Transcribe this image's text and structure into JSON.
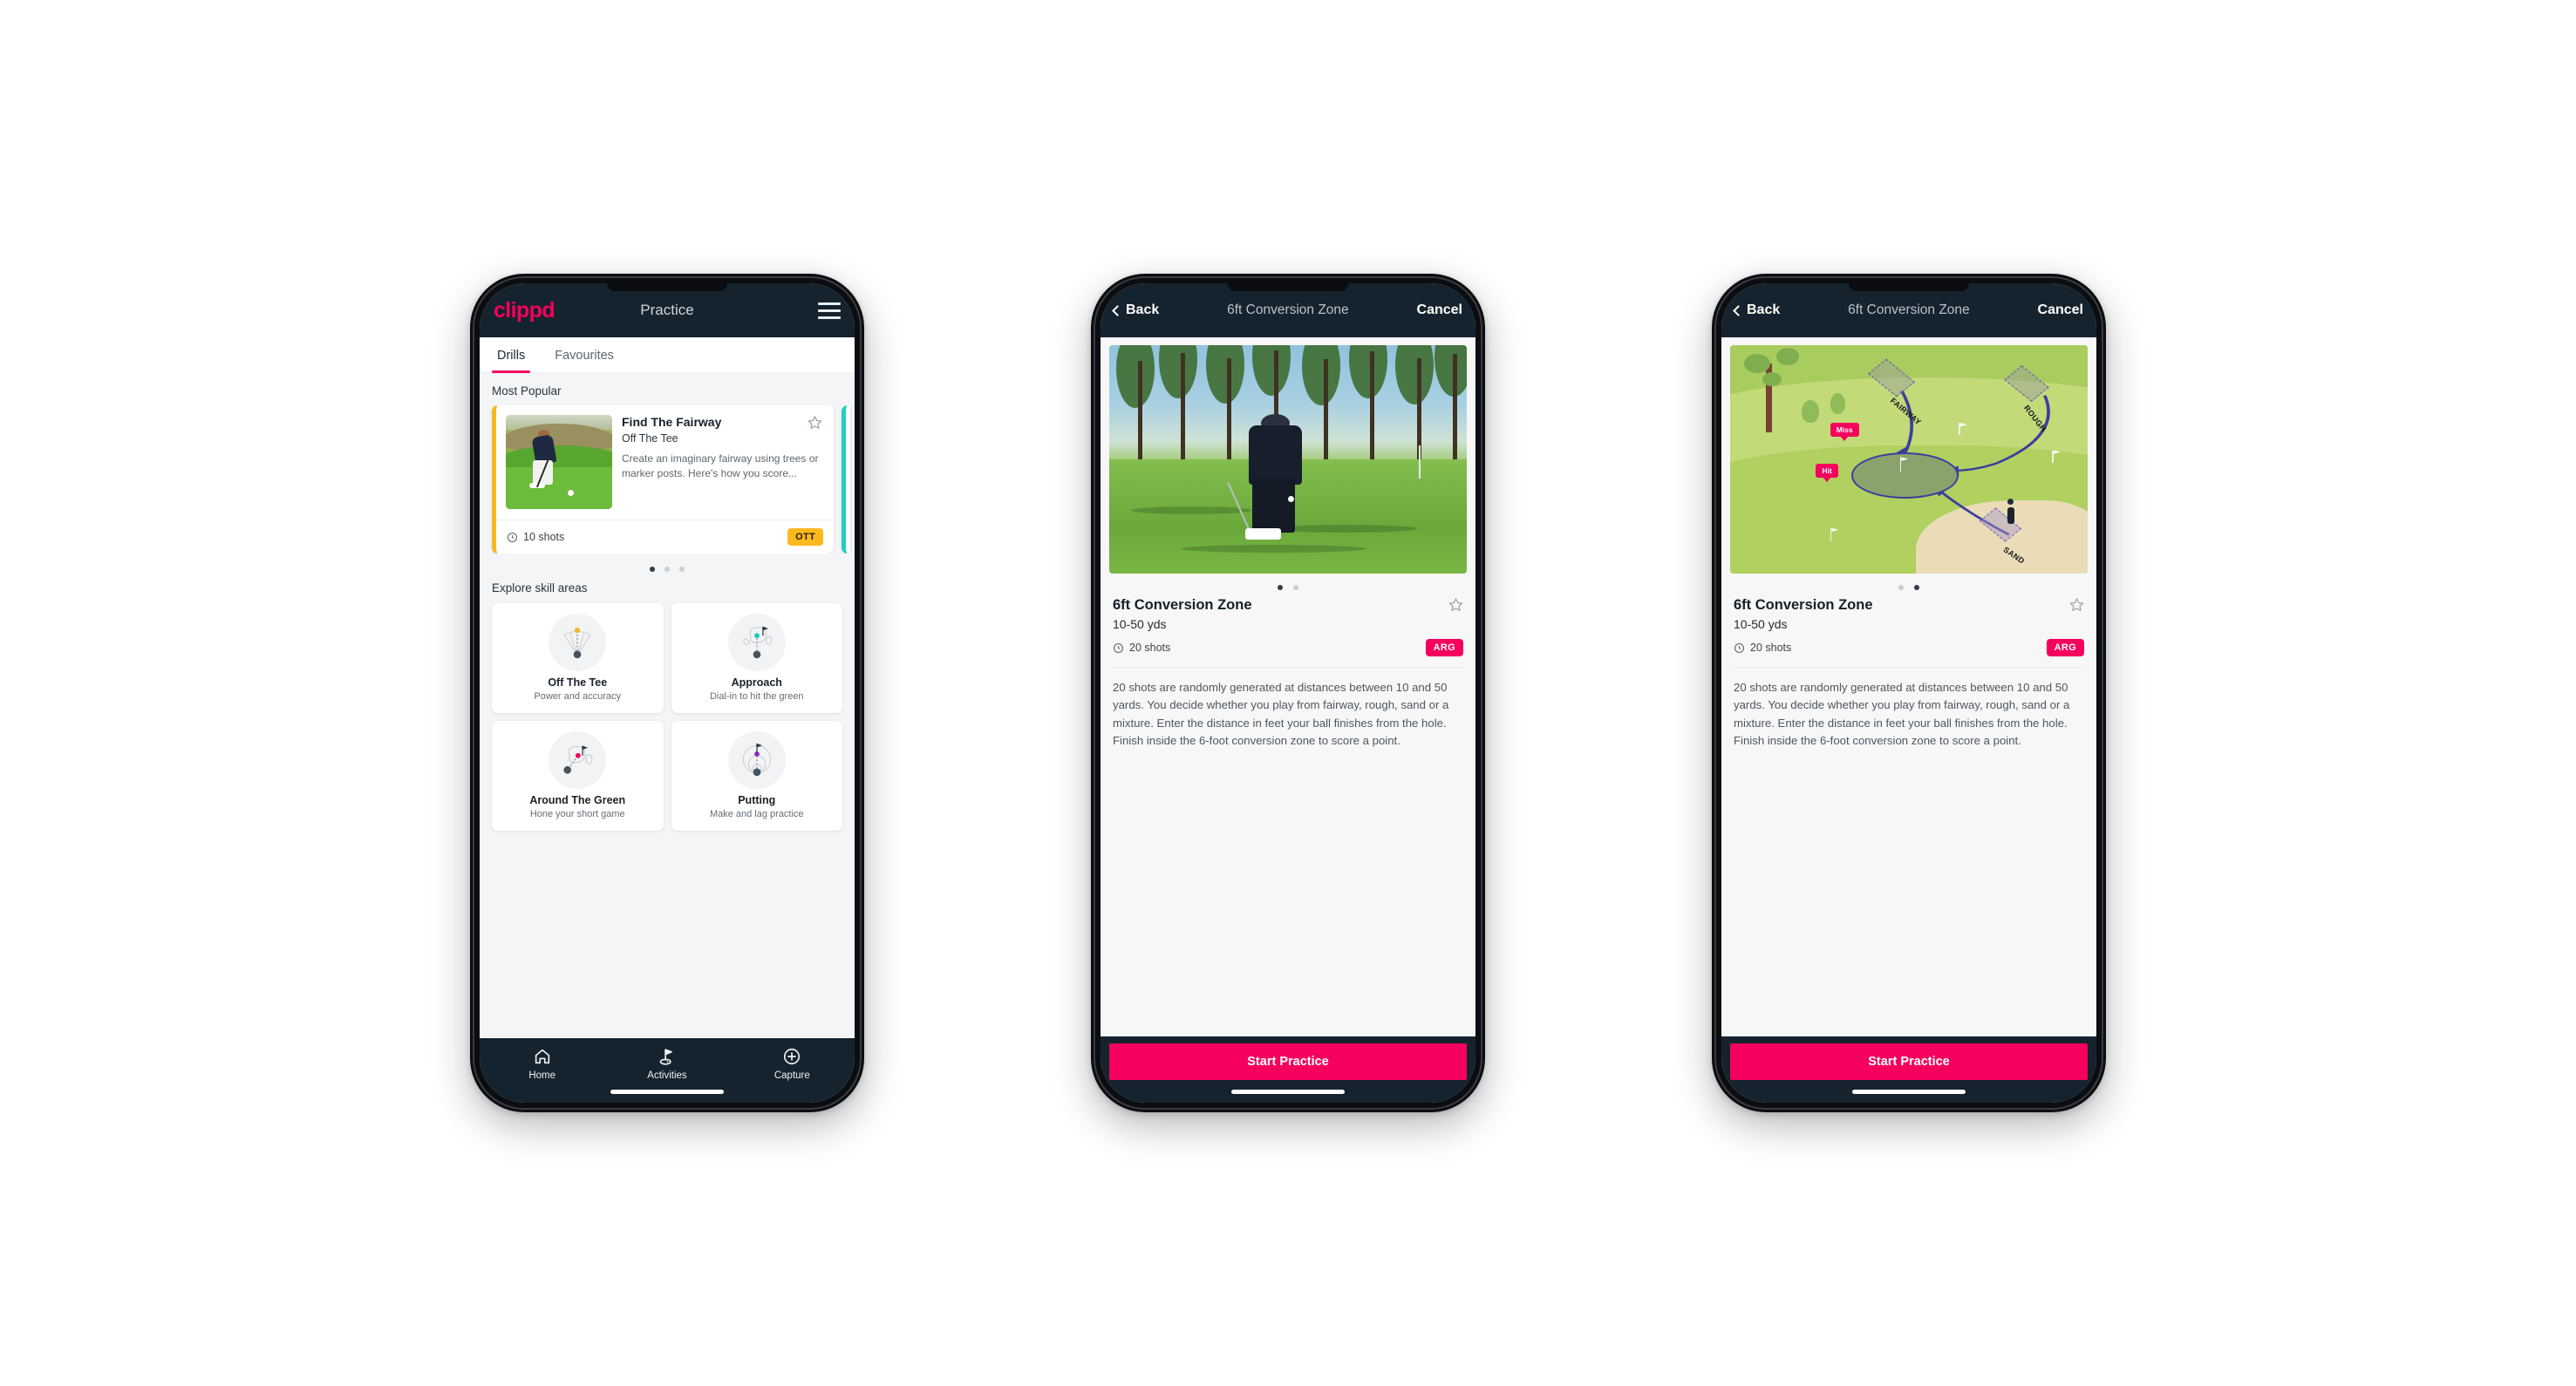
{
  "app": {
    "logo": "clippd",
    "accent_pink": "#f5005e",
    "header_navy": "#15232e",
    "badge_yellow": "#fcb91e",
    "accent_teal": "#21cfc0"
  },
  "phone1": {
    "appbar": {
      "title": "Practice",
      "menu_icon": "hamburger-icon"
    },
    "tabs": [
      {
        "label": "Drills",
        "active": true
      },
      {
        "label": "Favourites",
        "active": false
      }
    ],
    "most_popular": {
      "section_label": "Most Popular",
      "card": {
        "title": "Find The Fairway",
        "subtitle": "Off The Tee",
        "description": "Create an imaginary fairway using trees or marker posts. Here's how you score...",
        "shots": "10 shots",
        "badge": "OTT",
        "badge_color": "#fcb91e",
        "accent_color": "#f5b723",
        "favourite_icon": "star-outline-icon",
        "shots_icon": "clock-icon"
      },
      "dots": {
        "count": 3,
        "active_index": 0
      }
    },
    "skills": {
      "section_label": "Explore skill areas",
      "items": [
        {
          "name": "Off The Tee",
          "desc": "Power and accuracy",
          "icon": "tee-fan-icon",
          "dot_color": "#f5b723"
        },
        {
          "name": "Approach",
          "desc": "Dial-in to hit the green",
          "icon": "approach-green-icon",
          "dot_color": "#1fc9b6"
        },
        {
          "name": "Around The Green",
          "desc": "Hone your short game",
          "icon": "chip-green-icon",
          "dot_color": "#f5005e"
        },
        {
          "name": "Putting",
          "desc": "Make and lag practice",
          "icon": "putting-rings-icon",
          "dot_color": "#a12ad0"
        }
      ]
    },
    "bottomnav": [
      {
        "label": "Home",
        "icon": "home-icon",
        "active": false
      },
      {
        "label": "Activities",
        "icon": "golf-flag-icon",
        "active": true
      },
      {
        "label": "Capture",
        "icon": "plus-circle-icon",
        "active": false
      }
    ]
  },
  "phone2": {
    "appbar": {
      "back": "Back",
      "title": "6ft Conversion Zone",
      "cancel": "Cancel",
      "back_icon": "chevron-left-icon"
    },
    "hero": {
      "type": "photo",
      "alt": "golfer-chipping-photo"
    },
    "dots": {
      "count": 2,
      "active_index": 0
    },
    "detail": {
      "title": "6ft Conversion Zone",
      "subtitle": "10-50 yds",
      "shots": "20 shots",
      "badge": "ARG",
      "badge_color": "#f5005e",
      "favourite_icon": "star-outline-icon",
      "shots_icon": "clock-icon",
      "description": "20 shots are randomly generated at distances between 10 and 50 yards. You decide whether you play from fairway, rough, sand or a mixture. Enter the distance in feet your ball finishes from the hole. Finish inside the 6-foot conversion zone to score a point."
    },
    "cta": "Start Practice"
  },
  "phone3": {
    "appbar": {
      "back": "Back",
      "title": "6ft Conversion Zone",
      "cancel": "Cancel",
      "back_icon": "chevron-left-icon"
    },
    "hero": {
      "type": "illustration",
      "alt": "golf-course-diagram",
      "zone_labels": [
        "FAIRWAY",
        "ROUGH",
        "SAND"
      ],
      "result_tags": [
        "Miss",
        "Hit"
      ]
    },
    "dots": {
      "count": 2,
      "active_index": 1
    },
    "detail": {
      "title": "6ft Conversion Zone",
      "subtitle": "10-50 yds",
      "shots": "20 shots",
      "badge": "ARG",
      "badge_color": "#f5005e",
      "favourite_icon": "star-outline-icon",
      "shots_icon": "clock-icon",
      "description": "20 shots are randomly generated at distances between 10 and 50 yards. You decide whether you play from fairway, rough, sand or a mixture. Enter the distance in feet your ball finishes from the hole. Finish inside the 6-foot conversion zone to score a point."
    },
    "cta": "Start Practice"
  }
}
